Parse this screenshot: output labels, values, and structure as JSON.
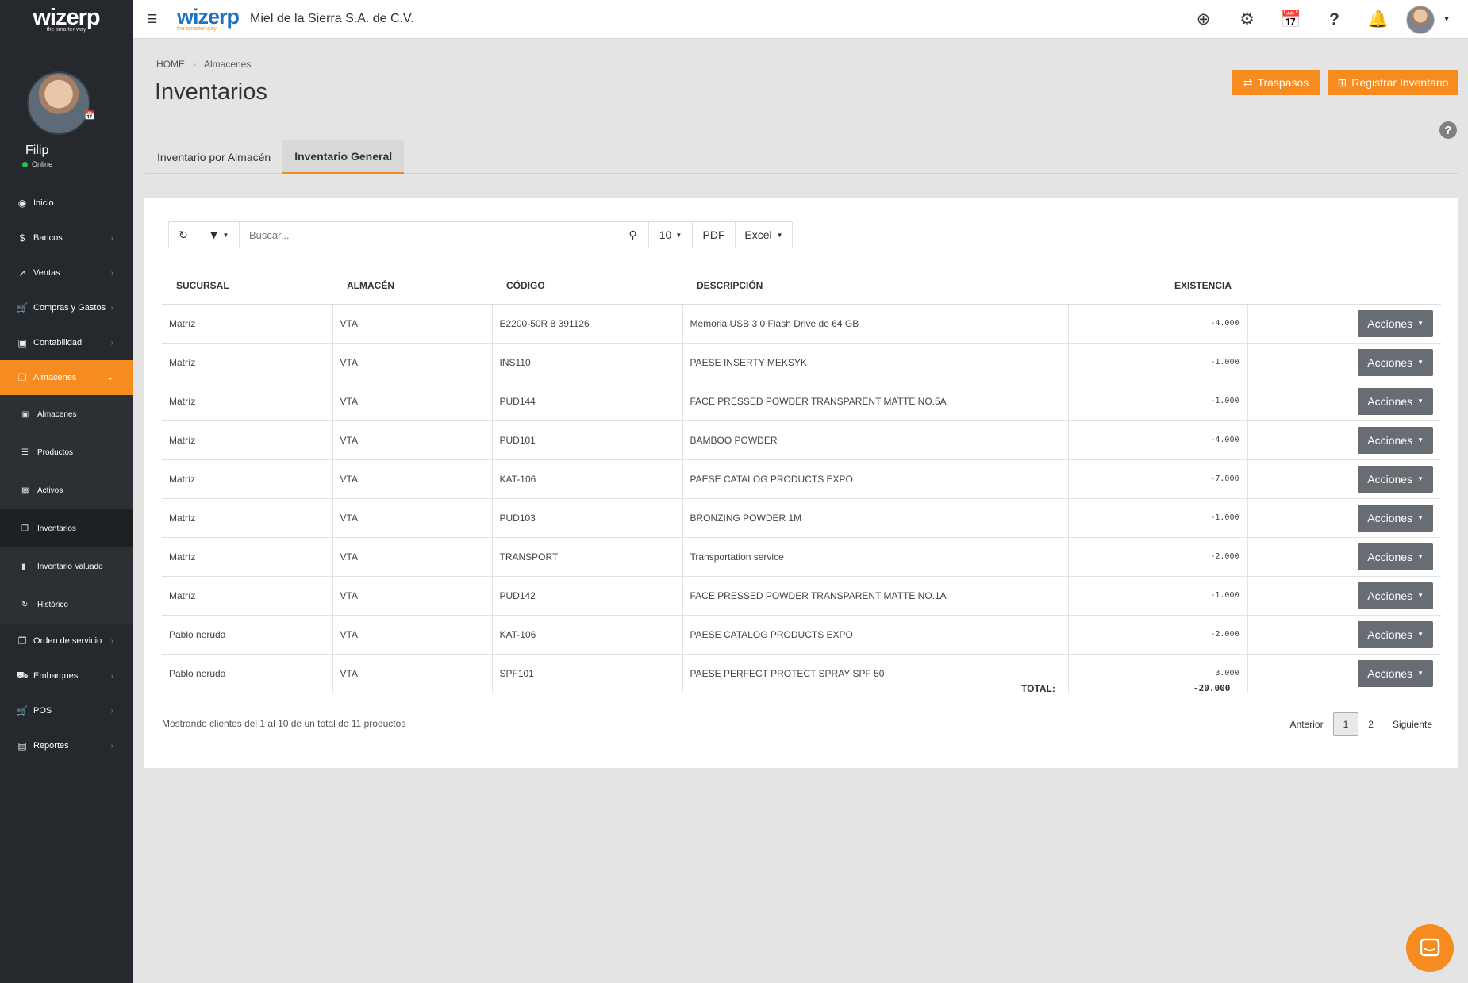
{
  "sidebar": {
    "logo": "wizerp",
    "logo_tag": "the smarter way",
    "user_name": "Filip",
    "user_status": "Online",
    "items": [
      {
        "label": "Inicio",
        "icon": "dashboard-icon"
      },
      {
        "label": "Bancos",
        "icon": "dollar-icon"
      },
      {
        "label": "Ventas",
        "icon": "line-chart-icon"
      },
      {
        "label": "Compras y Gastos",
        "icon": "cart-icon"
      },
      {
        "label": "Contabilidad",
        "icon": "money-icon"
      },
      {
        "label": "Almacenes",
        "icon": "files-icon",
        "active": true
      },
      {
        "label": "Orden de servicio",
        "icon": "files-icon"
      },
      {
        "label": "Embarques",
        "icon": "truck-icon"
      },
      {
        "label": "POS",
        "icon": "cart-icon"
      },
      {
        "label": "Reportes",
        "icon": "list-alt-icon"
      }
    ],
    "subitems": [
      {
        "label": "Almacenes",
        "icon": "cubes-icon"
      },
      {
        "label": "Productos",
        "icon": "list-icon"
      },
      {
        "label": "Activos",
        "icon": "archive-icon"
      },
      {
        "label": "Inventarios",
        "icon": "files-icon",
        "current": true
      },
      {
        "label": "Inventario Valuado",
        "icon": "file-icon"
      },
      {
        "label": "Histórico",
        "icon": "history-icon"
      }
    ]
  },
  "topbar": {
    "logo": "wizerp",
    "logo_tag": "the smarter way",
    "company": "Miel de la Sierra S.A. de C.V."
  },
  "breadcrumb": {
    "home": "HOME",
    "current": "Almacenes"
  },
  "page_title": "Inventarios",
  "buttons": {
    "traspasos": "Traspasos",
    "registrar": "Registrar Inventario"
  },
  "tabs": [
    "Inventario por Almacén",
    "Inventario General"
  ],
  "toolbar": {
    "search_placeholder": "Buscar...",
    "page_size": "10",
    "pdf": "PDF",
    "excel": "Excel"
  },
  "table": {
    "headers": [
      "SUCURSAL",
      "ALMACÉN",
      "CÓDIGO",
      "DESCRIPCIÓN",
      "EXISTENCIA"
    ],
    "action_label": "Acciones",
    "rows": [
      [
        "Matríz",
        "VTA",
        "E2200-50R 8 391126",
        "Memoria USB 3 0 Flash Drive de 64 GB",
        "-4.000"
      ],
      [
        "Matríz",
        "VTA",
        "INS110",
        "PAESE INSERTY MEKSYK",
        "-1.000"
      ],
      [
        "Matríz",
        "VTA",
        "PUD144",
        "FACE PRESSED POWDER TRANSPARENT MATTE NO.5A",
        "-1.000"
      ],
      [
        "Matríz",
        "VTA",
        "PUD101",
        "BAMBOO POWDER",
        "-4.000"
      ],
      [
        "Matríz",
        "VTA",
        "KAT-106",
        "PAESE CATALOG PRODUCTS EXPO",
        "-7.000"
      ],
      [
        "Matríz",
        "VTA",
        "PUD103",
        "BRONZING POWDER 1M",
        "-1.000"
      ],
      [
        "Matríz",
        "VTA",
        "TRANSPORT",
        "Transportation service",
        "-2.000"
      ],
      [
        "Matríz",
        "VTA",
        "PUD142",
        "FACE PRESSED POWDER TRANSPARENT MATTE NO.1A",
        "-1.000"
      ],
      [
        "Pablo neruda",
        "VTA",
        "KAT-106",
        "PAESE CATALOG PRODUCTS EXPO",
        "-2.000"
      ],
      [
        "Pablo neruda",
        "VTA",
        "SPF101",
        "PAESE PERFECT PROTECT SPRAY SPF 50",
        "3.000"
      ]
    ],
    "total_label": "TOTAL:",
    "total_value": "-20.000"
  },
  "footer": {
    "info": "Mostrando clientes del 1 al 10 de un total de 11 productos",
    "prev": "Anterior",
    "pages": [
      "1",
      "2"
    ],
    "next": "Siguiente"
  },
  "colors": {
    "accent": "#f68b1f",
    "sidebar": "#25282c",
    "brand_blue": "#1e73be"
  }
}
